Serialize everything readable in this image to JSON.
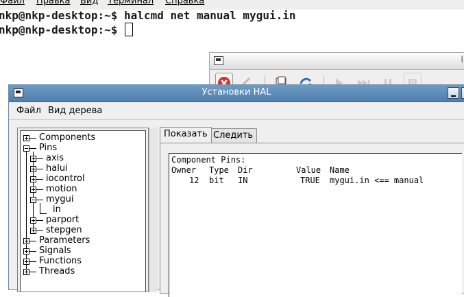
{
  "terminal": {
    "menu": [
      "Файл",
      "Правка",
      "Вид",
      "Терминал",
      "Справка"
    ],
    "line1_prompt": "nkp@nkp-desktop:~$ ",
    "line1_command": "halcmd net manual mygui.in",
    "line2_prompt": "nkp@nkp-desktop:~$ "
  },
  "background_window": {
    "title_fragment": "l"
  },
  "hal_window": {
    "title": "Установки HAL",
    "menu": [
      "Файл",
      "Вид дерева"
    ]
  },
  "tree": {
    "items": [
      {
        "label": "Components",
        "expander": "+"
      },
      {
        "label": "Pins",
        "expander": "-"
      },
      {
        "label": "axis",
        "expander": "+"
      },
      {
        "label": "halui",
        "expander": "+"
      },
      {
        "label": "iocontrol",
        "expander": "+"
      },
      {
        "label": "motion",
        "expander": "+"
      },
      {
        "label": "mygui",
        "expander": "-"
      },
      {
        "label": "in",
        "expander": ""
      },
      {
        "label": "parport",
        "expander": "+"
      },
      {
        "label": "stepgen",
        "expander": "+"
      },
      {
        "label": "Parameters",
        "expander": "+"
      },
      {
        "label": "Signals",
        "expander": "+"
      },
      {
        "label": "Functions",
        "expander": "+"
      },
      {
        "label": "Threads",
        "expander": "+"
      }
    ]
  },
  "tabs": [
    {
      "label": "Показать",
      "active": true
    },
    {
      "label": "Следить",
      "active": false
    }
  ],
  "content": {
    "heading": "Component Pins:",
    "columns": [
      "Owner",
      "Type",
      "Dir",
      "Value",
      "Name"
    ],
    "rows": [
      {
        "owner": "12",
        "type": "bit",
        "dir": "IN",
        "value": "TRUE",
        "name": "mygui.in <== manual"
      }
    ]
  },
  "colors": {
    "titlebar_active": "#5a89b8",
    "close_button": "#d0342c"
  }
}
